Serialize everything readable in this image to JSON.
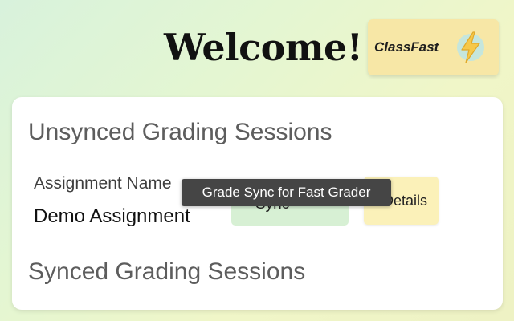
{
  "header": {
    "title": "Welcome!",
    "logo_text": "ClassFast",
    "logo_icon": "lightning-bolt-icon",
    "logo_bg_color": "#f7e7a6"
  },
  "unsynced": {
    "heading": "Unsynced Grading Sessions",
    "assignment_label": "Assignment Name",
    "assignment_value": "Demo Assignment",
    "sync_button_label": "Sync",
    "details_button_label": "Details"
  },
  "synced": {
    "heading": "Synced Grading Sessions"
  },
  "tooltip": {
    "text": "Grade Sync for Fast Grader"
  },
  "colors": {
    "sync_button": "#d7f0d4",
    "details_button": "#fbf1b9",
    "tooltip_bg": "#454545"
  }
}
